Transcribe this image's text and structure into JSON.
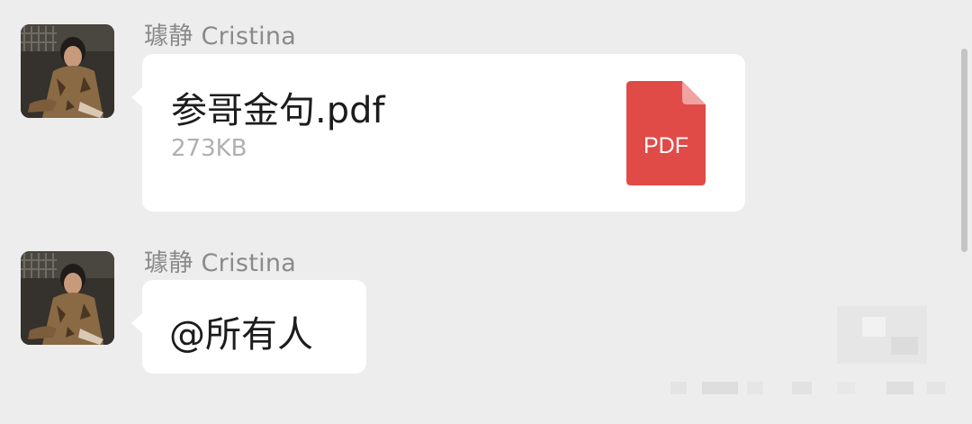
{
  "messages": [
    {
      "sender": "璩静 Cristina",
      "type": "file",
      "file_name": "参哥金句.pdf",
      "file_size": "273KB",
      "file_icon": "pdf-file-icon",
      "file_icon_label": "PDF",
      "file_icon_color": "#e04b48"
    },
    {
      "sender": "璩静 Cristina",
      "type": "text",
      "text": "@所有人"
    }
  ],
  "colors": {
    "background": "#ededed",
    "bubble": "#ffffff",
    "sender_name": "#8a8a8a",
    "file_size": "#b0b0b0"
  }
}
